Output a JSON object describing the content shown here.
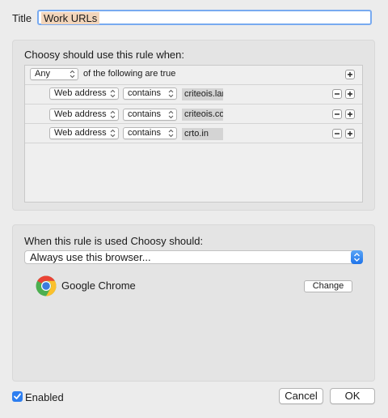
{
  "title": {
    "label": "Title",
    "value": "Work URLs"
  },
  "rule_section": {
    "heading": "Choosy should use this rule when:",
    "match_mode": "Any",
    "match_suffix": "of the following are true",
    "conditions": [
      {
        "field": "Web address",
        "operator": "contains",
        "value": "criteois.lan"
      },
      {
        "field": "Web address",
        "operator": "contains",
        "value": "criteois.cor"
      },
      {
        "field": "Web address",
        "operator": "contains",
        "value": "crto.in"
      }
    ]
  },
  "action_section": {
    "heading": "When this rule is used Choosy should:",
    "action": "Always use this browser...",
    "browser_name": "Google Chrome",
    "change_label": "Change"
  },
  "footer": {
    "enabled_label": "Enabled",
    "enabled": true,
    "cancel_label": "Cancel",
    "ok_label": "OK"
  },
  "colors": {
    "accent": "#2d7ef0",
    "title_selection": "#f2d5bb"
  }
}
